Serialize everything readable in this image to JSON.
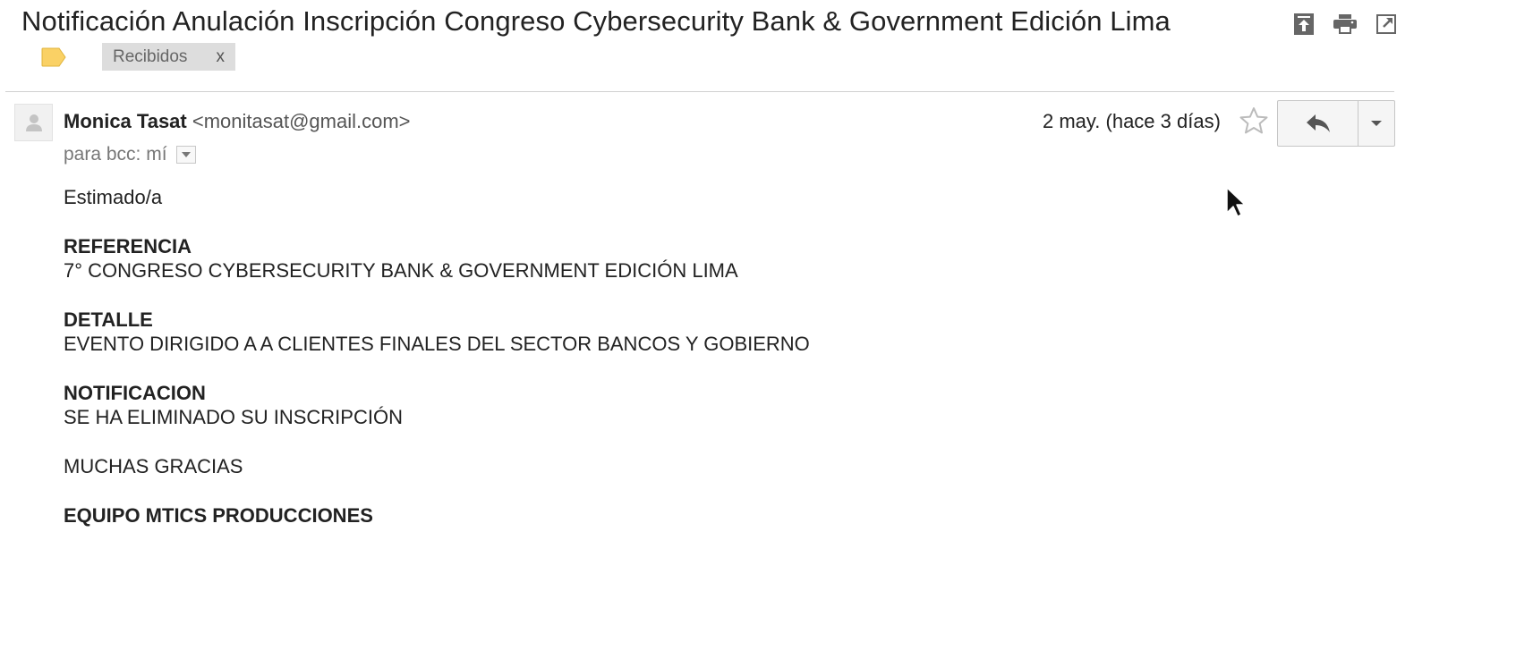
{
  "email": {
    "subject": "Notificación Anulación Inscripción Congreso Cybersecurity Bank & Government Edición Lima",
    "label_chip": "Recibidos",
    "label_chip_remove": "x",
    "sender_name": "Monica Tasat",
    "sender_email": "<monitasat@gmail.com>",
    "recipients": "para bcc: mí",
    "date": "2 may. (hace 3 días)"
  },
  "body": {
    "greeting": "Estimado/a",
    "ref_heading": "REFERENCIA",
    "ref_text": "7° CONGRESO CYBERSECURITY BANK & GOVERNMENT EDICIÓN LIMA",
    "detail_heading": "DETALLE",
    "detail_text": "EVENTO DIRIGIDO A A CLIENTES FINALES DEL SECTOR BANCOS Y GOBIERNO",
    "notif_heading": "NOTIFICACION",
    "notif_text": "SE HA ELIMINADO SU INSCRIPCIÓN",
    "thanks": "MUCHAS GRACIAS",
    "signature": "EQUIPO MTICS PRODUCCIONES"
  },
  "icons": {
    "toolbar": [
      "expand-all-icon",
      "print-icon",
      "open-new-window-icon"
    ],
    "label": "label-tag-icon",
    "avatar": "person-icon",
    "star": "star-icon",
    "reply": "reply-icon",
    "more": "chevron-down-icon"
  },
  "colors": {
    "label_tag": "#fad165",
    "chip_bg": "#dddddd"
  }
}
